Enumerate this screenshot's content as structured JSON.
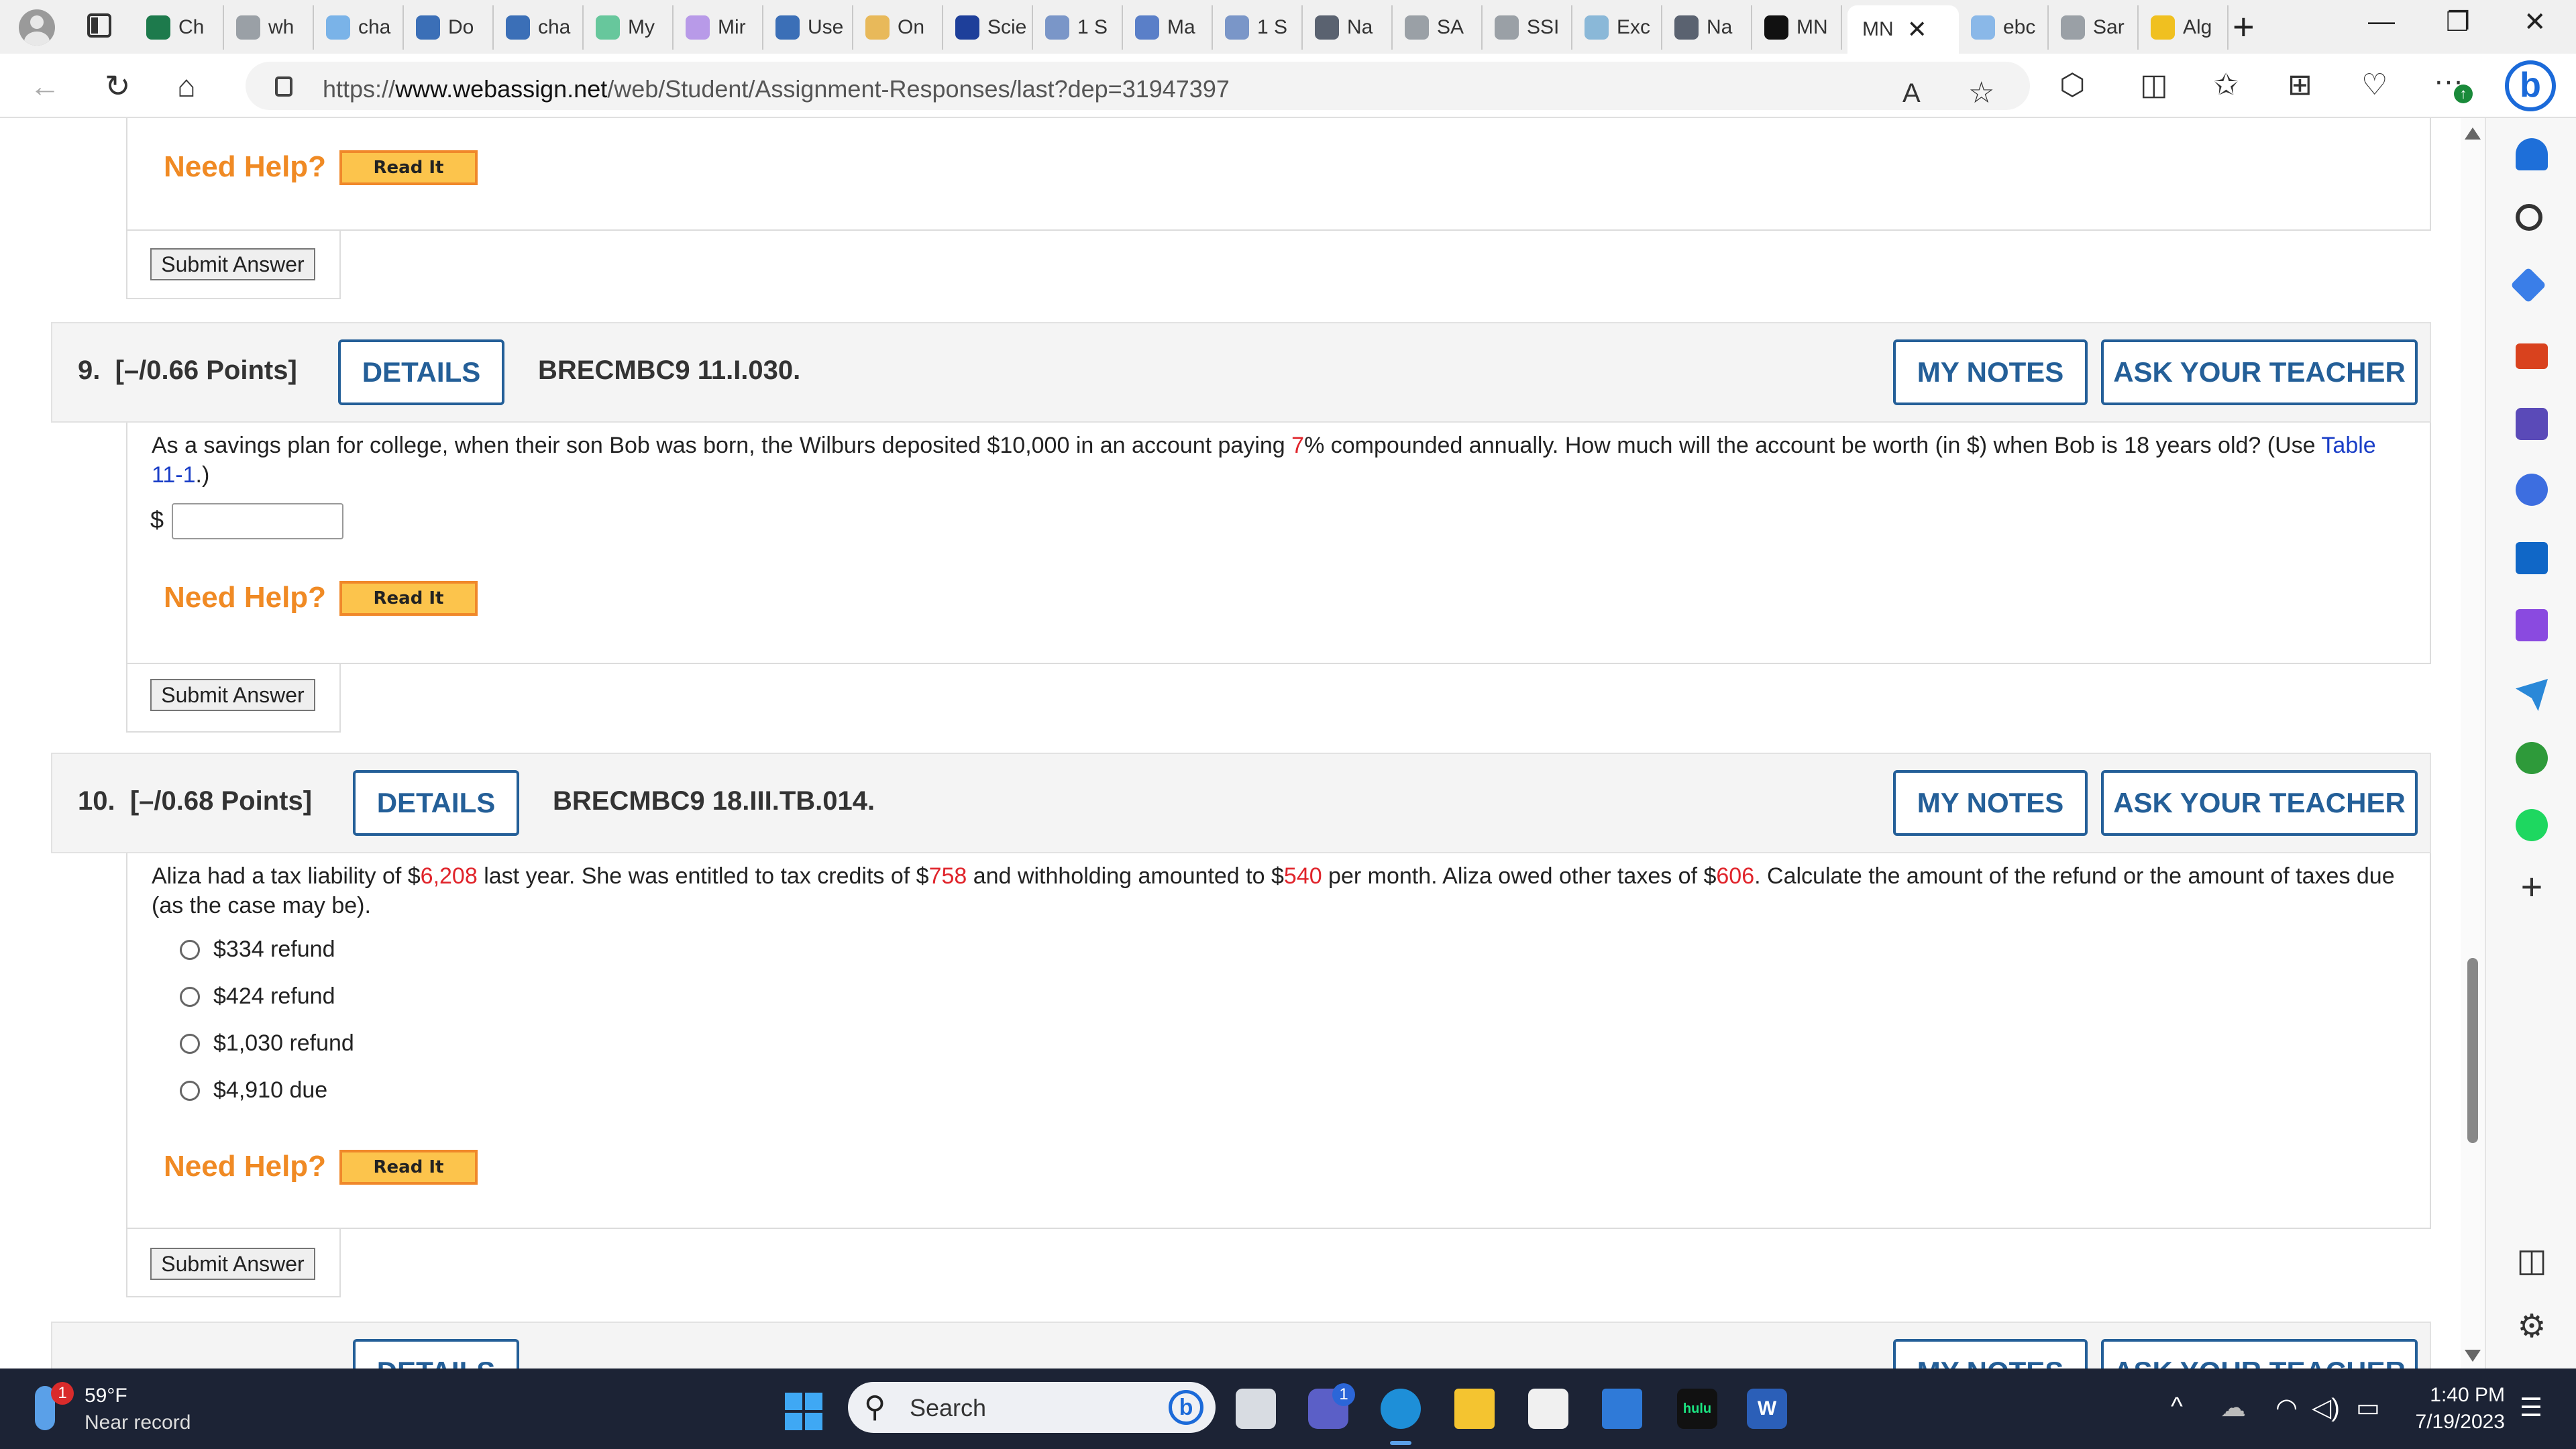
{
  "browser": {
    "tabs": [
      {
        "label": "Ch",
        "color": "#1d7a4c"
      },
      {
        "label": "wh",
        "color": "#9aa0a6"
      },
      {
        "label": "cha",
        "color": "#7ab3e8"
      },
      {
        "label": "Do",
        "color": "#3b6fb7"
      },
      {
        "label": "cha",
        "color": "#3b6fb7"
      },
      {
        "label": "My",
        "color": "#67c79c"
      },
      {
        "label": "Mir",
        "color": "#b89ae8"
      },
      {
        "label": "Use",
        "color": "#3b6fb7"
      },
      {
        "label": "On",
        "color": "#e8b95a"
      },
      {
        "label": "Scie",
        "color": "#1e3f9a"
      },
      {
        "label": "1 S",
        "color": "#7a96c8"
      },
      {
        "label": "Ma",
        "color": "#5a7fc8"
      },
      {
        "label": "1 S",
        "color": "#7a96c8"
      },
      {
        "label": "Na",
        "color": "#5a6270"
      },
      {
        "label": "SA",
        "color": "#9aa0a6"
      },
      {
        "label": "SSI",
        "color": "#9aa0a6"
      },
      {
        "label": "Exc",
        "color": "#8ab8d8"
      },
      {
        "label": "Na",
        "color": "#5a6270"
      },
      {
        "label": "MN",
        "color": "#111111"
      },
      {
        "label": "MN",
        "color": "#ffffff",
        "active": true
      },
      {
        "label": "ebc",
        "color": "#8ab8e8"
      },
      {
        "label": "Sar",
        "color": "#9aa0a6"
      },
      {
        "label": "Alg",
        "color": "#f0c020"
      }
    ],
    "active_tab_close": "✕",
    "new_tab": "+",
    "minimize": "—",
    "restore": "❐",
    "close": "✕",
    "url_prefix": "https://",
    "url_domain": "www.webassign.net",
    "url_path": "/web/Student/Assignment-Responses/last?dep=31947397",
    "back": "←",
    "reload": "↻",
    "home": "⌂",
    "read_aloud": "A",
    "favorite": "☆",
    "extensions": "⬡",
    "split": "◫",
    "favorites": "✩",
    "collections": "⊞",
    "performance": "♡",
    "menu": "···",
    "bing": "b",
    "update_badge": "↑"
  },
  "top_block": {
    "need_help": "Need Help?",
    "read_it": "Read It",
    "submit": "Submit Answer"
  },
  "q9": {
    "number": "9.",
    "points": "[–/0.66 Points]",
    "details": "DETAILS",
    "code": "BRECMBC9 11.I.030.",
    "my_notes": "MY NOTES",
    "ask_teacher": "ASK YOUR TEACHER",
    "text_1": "As a savings plan for college, when their son Bob was born, the Wilburs deposited $10,000 in an account paying ",
    "rate": "7",
    "text_2": "% compounded annually. How much will the account be worth (in $) when Bob is 18 years old? (Use ",
    "table_link": "Table 11-1",
    "text_3": ".)",
    "dollar": "$",
    "answer_value": "",
    "need_help": "Need Help?",
    "read_it": "Read It",
    "submit": "Submit Answer"
  },
  "q10": {
    "number": "10.",
    "points": "[–/0.68 Points]",
    "details": "DETAILS",
    "code": "BRECMBC9 18.III.TB.014.",
    "my_notes": "MY NOTES",
    "ask_teacher": "ASK YOUR TEACHER",
    "t1": "Aliza had a tax liability of $",
    "v1": "6,208",
    "t2": " last year. She was entitled to tax credits of $",
    "v2": "758",
    "t3": " and withholding amounted to $",
    "v3": "540",
    "t4": " per month. Aliza owed other taxes of $",
    "v4": "606",
    "t5": ". Calculate the amount of the refund or the amount of taxes due (as the case may be).",
    "options": [
      "$334 refund",
      "$424 refund",
      "$1,030 refund",
      "$4,910 due"
    ],
    "need_help": "Need Help?",
    "read_it": "Read It",
    "submit": "Submit Answer"
  },
  "q11_partial": {
    "details": "DETAILS",
    "my_notes": "MY NOTES",
    "ask_teacher": "ASK YOUR TEACHER"
  },
  "sidebar": {
    "icons": [
      "bell-icon",
      "search-icon",
      "tag-icon",
      "toolbox-icon",
      "games-icon",
      "office-icon",
      "outlook-icon",
      "designer-icon",
      "send-icon",
      "tree-icon",
      "spotify-icon"
    ],
    "add": "+",
    "panel": "◫",
    "settings": "⚙"
  },
  "taskbar": {
    "weather_badge": "1",
    "temperature": "59°F",
    "weather_note": "Near record",
    "search_placeholder": "Search",
    "teams_badge": "1",
    "hulu_label": "hulu",
    "word_label": "W",
    "time": "1:40 PM",
    "date": "7/19/2023",
    "tray_chevron": "^",
    "wifi": "◠",
    "volume": "◁)",
    "battery": "▭"
  }
}
